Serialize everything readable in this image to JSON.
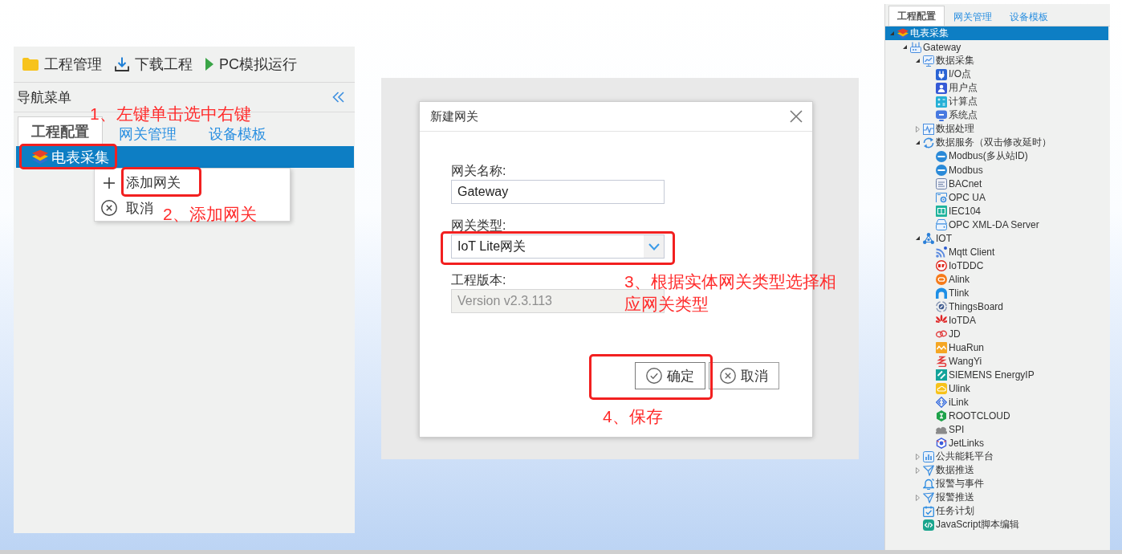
{
  "left_panel": {
    "toolbar": [
      {
        "label": "工程管理",
        "kind": "folder"
      },
      {
        "label": "下载工程",
        "kind": "download"
      },
      {
        "label": "PC模拟运行",
        "kind": "run"
      }
    ],
    "nav_title": "导航菜单",
    "tabs": [
      {
        "label": "工程配置",
        "selected": true
      },
      {
        "label": "网关管理",
        "selected": false
      },
      {
        "label": "设备模板",
        "selected": false
      }
    ],
    "tree": [
      {
        "label": "电表采集",
        "kind": "project",
        "selected": true
      }
    ],
    "context_menu": [
      {
        "label": "添加网关",
        "kind": "add"
      },
      {
        "label": "取消",
        "kind": "cancel"
      }
    ]
  },
  "dialog": {
    "title": "新建网关",
    "fields": [
      {
        "label": "网关名称:",
        "value": "Gateway",
        "kind": "text",
        "disabled": false
      },
      {
        "label": "网关类型:",
        "value": "IoT Lite网关",
        "kind": "select",
        "disabled": false
      },
      {
        "label": "工程版本:",
        "value": "Version v2.3.113",
        "kind": "text",
        "disabled": true
      }
    ],
    "buttons": [
      {
        "label": "确定",
        "kind": "ok"
      },
      {
        "label": "取消",
        "kind": "cancel"
      }
    ]
  },
  "right_panel": {
    "tabs": [
      {
        "label": "工程配置",
        "selected": true
      },
      {
        "label": "网关管理",
        "selected": false
      },
      {
        "label": "设备模板",
        "selected": false
      }
    ],
    "tree": [
      {
        "label": "电表采集",
        "kind": "project",
        "selected": true,
        "expanded": true,
        "children": [
          {
            "label": "Gateway",
            "kind": "gateway",
            "selected": false,
            "expanded": true,
            "children": [
              {
                "label": "数据采集",
                "kind": "collect",
                "selected": false,
                "expanded": true,
                "children": [
                  {
                    "label": "I/O点",
                    "kind": "io",
                    "selected": false
                  },
                  {
                    "label": "用户点",
                    "kind": "userpoint",
                    "selected": false
                  },
                  {
                    "label": "计算点",
                    "kind": "calcpoint",
                    "selected": false
                  },
                  {
                    "label": "系统点",
                    "kind": "syspoint",
                    "selected": false
                  }
                ]
              },
              {
                "label": "数据处理",
                "kind": "process",
                "selected": false,
                "expanded": false
              },
              {
                "label": "数据服务（双击修改延时）",
                "kind": "service",
                "selected": false,
                "expanded": true,
                "children": [
                  {
                    "label": "Modbus(多从站ID)",
                    "kind": "modbus",
                    "selected": false
                  },
                  {
                    "label": "Modbus",
                    "kind": "modbus",
                    "selected": false
                  },
                  {
                    "label": "BACnet",
                    "kind": "bacnet",
                    "selected": false
                  },
                  {
                    "label": "OPC UA",
                    "kind": "opcua",
                    "selected": false
                  },
                  {
                    "label": "IEC104",
                    "kind": "iec",
                    "selected": false
                  },
                  {
                    "label": "OPC XML-DA Server",
                    "kind": "opcxml",
                    "selected": false
                  }
                ]
              },
              {
                "label": "IOT",
                "kind": "iot",
                "selected": false,
                "expanded": true,
                "children": [
                  {
                    "label": "Mqtt Client",
                    "kind": "mqtt",
                    "selected": false
                  },
                  {
                    "label": "IoTDDC",
                    "kind": "iotddc",
                    "selected": false
                  },
                  {
                    "label": "Alink",
                    "kind": "alink",
                    "selected": false
                  },
                  {
                    "label": "Tlink",
                    "kind": "tlink",
                    "selected": false
                  },
                  {
                    "label": "ThingsBoard",
                    "kind": "thingsboard",
                    "selected": false
                  },
                  {
                    "label": "IoTDA",
                    "kind": "iotda",
                    "selected": false
                  },
                  {
                    "label": "JD",
                    "kind": "jd",
                    "selected": false
                  },
                  {
                    "label": "HuaRun",
                    "kind": "huarun",
                    "selected": false
                  },
                  {
                    "label": "WangYi",
                    "kind": "wangyi",
                    "selected": false
                  },
                  {
                    "label": "SIEMENS EnergyIP",
                    "kind": "siemens",
                    "selected": false
                  },
                  {
                    "label": "Ulink",
                    "kind": "ulink",
                    "selected": false
                  },
                  {
                    "label": "iLink",
                    "kind": "ilink",
                    "selected": false
                  },
                  {
                    "label": "ROOTCLOUD",
                    "kind": "rootcloud",
                    "selected": false
                  },
                  {
                    "label": "SPI",
                    "kind": "spi",
                    "selected": false
                  },
                  {
                    "label": "JetLinks",
                    "kind": "jetlinks",
                    "selected": false
                  }
                ]
              },
              {
                "label": "公共能耗平台",
                "kind": "energy",
                "selected": false,
                "expanded": false
              },
              {
                "label": "数据推送",
                "kind": "push",
                "selected": false,
                "expanded": false
              },
              {
                "label": "报警与事件",
                "kind": "alarm",
                "selected": false
              },
              {
                "label": "报警推送",
                "kind": "push",
                "selected": false,
                "expanded": false
              },
              {
                "label": "任务计划",
                "kind": "schedule",
                "selected": false
              },
              {
                "label": "JavaScript脚本编辑",
                "kind": "script",
                "selected": false
              }
            ]
          }
        ]
      }
    ]
  },
  "annotations": [
    {
      "text": "1、左键单击选中右键"
    },
    {
      "text": "2、添加网关"
    },
    {
      "text": "3、根据实体网关类型选择相应网关类型"
    },
    {
      "text": "4、保存"
    }
  ]
}
